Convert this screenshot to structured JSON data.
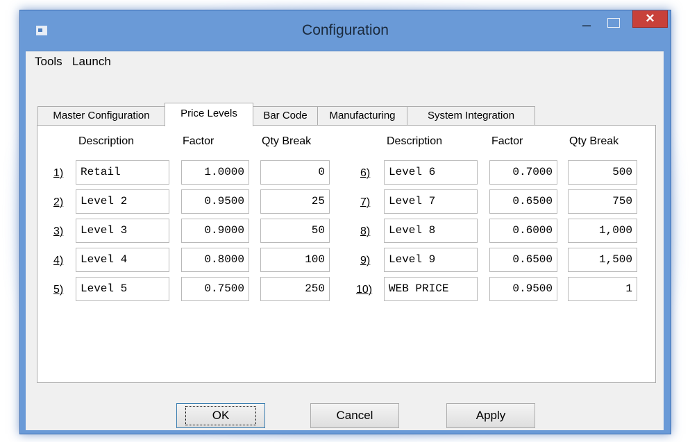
{
  "window": {
    "title": "Configuration",
    "close_glyph": "✕",
    "minimize_glyph": "–"
  },
  "menu": [
    "Tools",
    "Launch"
  ],
  "tabs": [
    "Master Configuration",
    "Price Levels",
    "Bar Code",
    "Manufacturing",
    "System Integration"
  ],
  "active_tab": "Price Levels",
  "headers": {
    "description": "Description",
    "factor": "Factor",
    "qty_break": "Qty Break"
  },
  "price_levels_left": [
    {
      "num": "1)",
      "description": "Retail",
      "factor": "1.0000",
      "qty": "0"
    },
    {
      "num": "2)",
      "description": "Level 2",
      "factor": "0.9500",
      "qty": "25"
    },
    {
      "num": "3)",
      "description": "Level 3",
      "factor": "0.9000",
      "qty": "50"
    },
    {
      "num": "4)",
      "description": "Level 4",
      "factor": "0.8000",
      "qty": "100"
    },
    {
      "num": "5)",
      "description": "Level 5",
      "factor": "0.7500",
      "qty": "250"
    }
  ],
  "price_levels_right": [
    {
      "num": "6)",
      "description": "Level 6",
      "factor": "0.7000",
      "qty": "500"
    },
    {
      "num": "7)",
      "description": "Level 7",
      "factor": "0.6500",
      "qty": "750"
    },
    {
      "num": "8)",
      "description": "Level 8",
      "factor": "0.6000",
      "qty": "1,000"
    },
    {
      "num": "9)",
      "description": "Level 9",
      "factor": "0.6500",
      "qty": "1,500"
    },
    {
      "num": "10)",
      "description": "WEB PRICE",
      "factor": "0.9500",
      "qty": "1"
    }
  ],
  "buttons": {
    "ok": "OK",
    "cancel": "Cancel",
    "apply": "Apply"
  },
  "colors": {
    "title_bar": "#6a9ad7",
    "close_button": "#c8413a",
    "client_bg": "#f0f0f0"
  }
}
